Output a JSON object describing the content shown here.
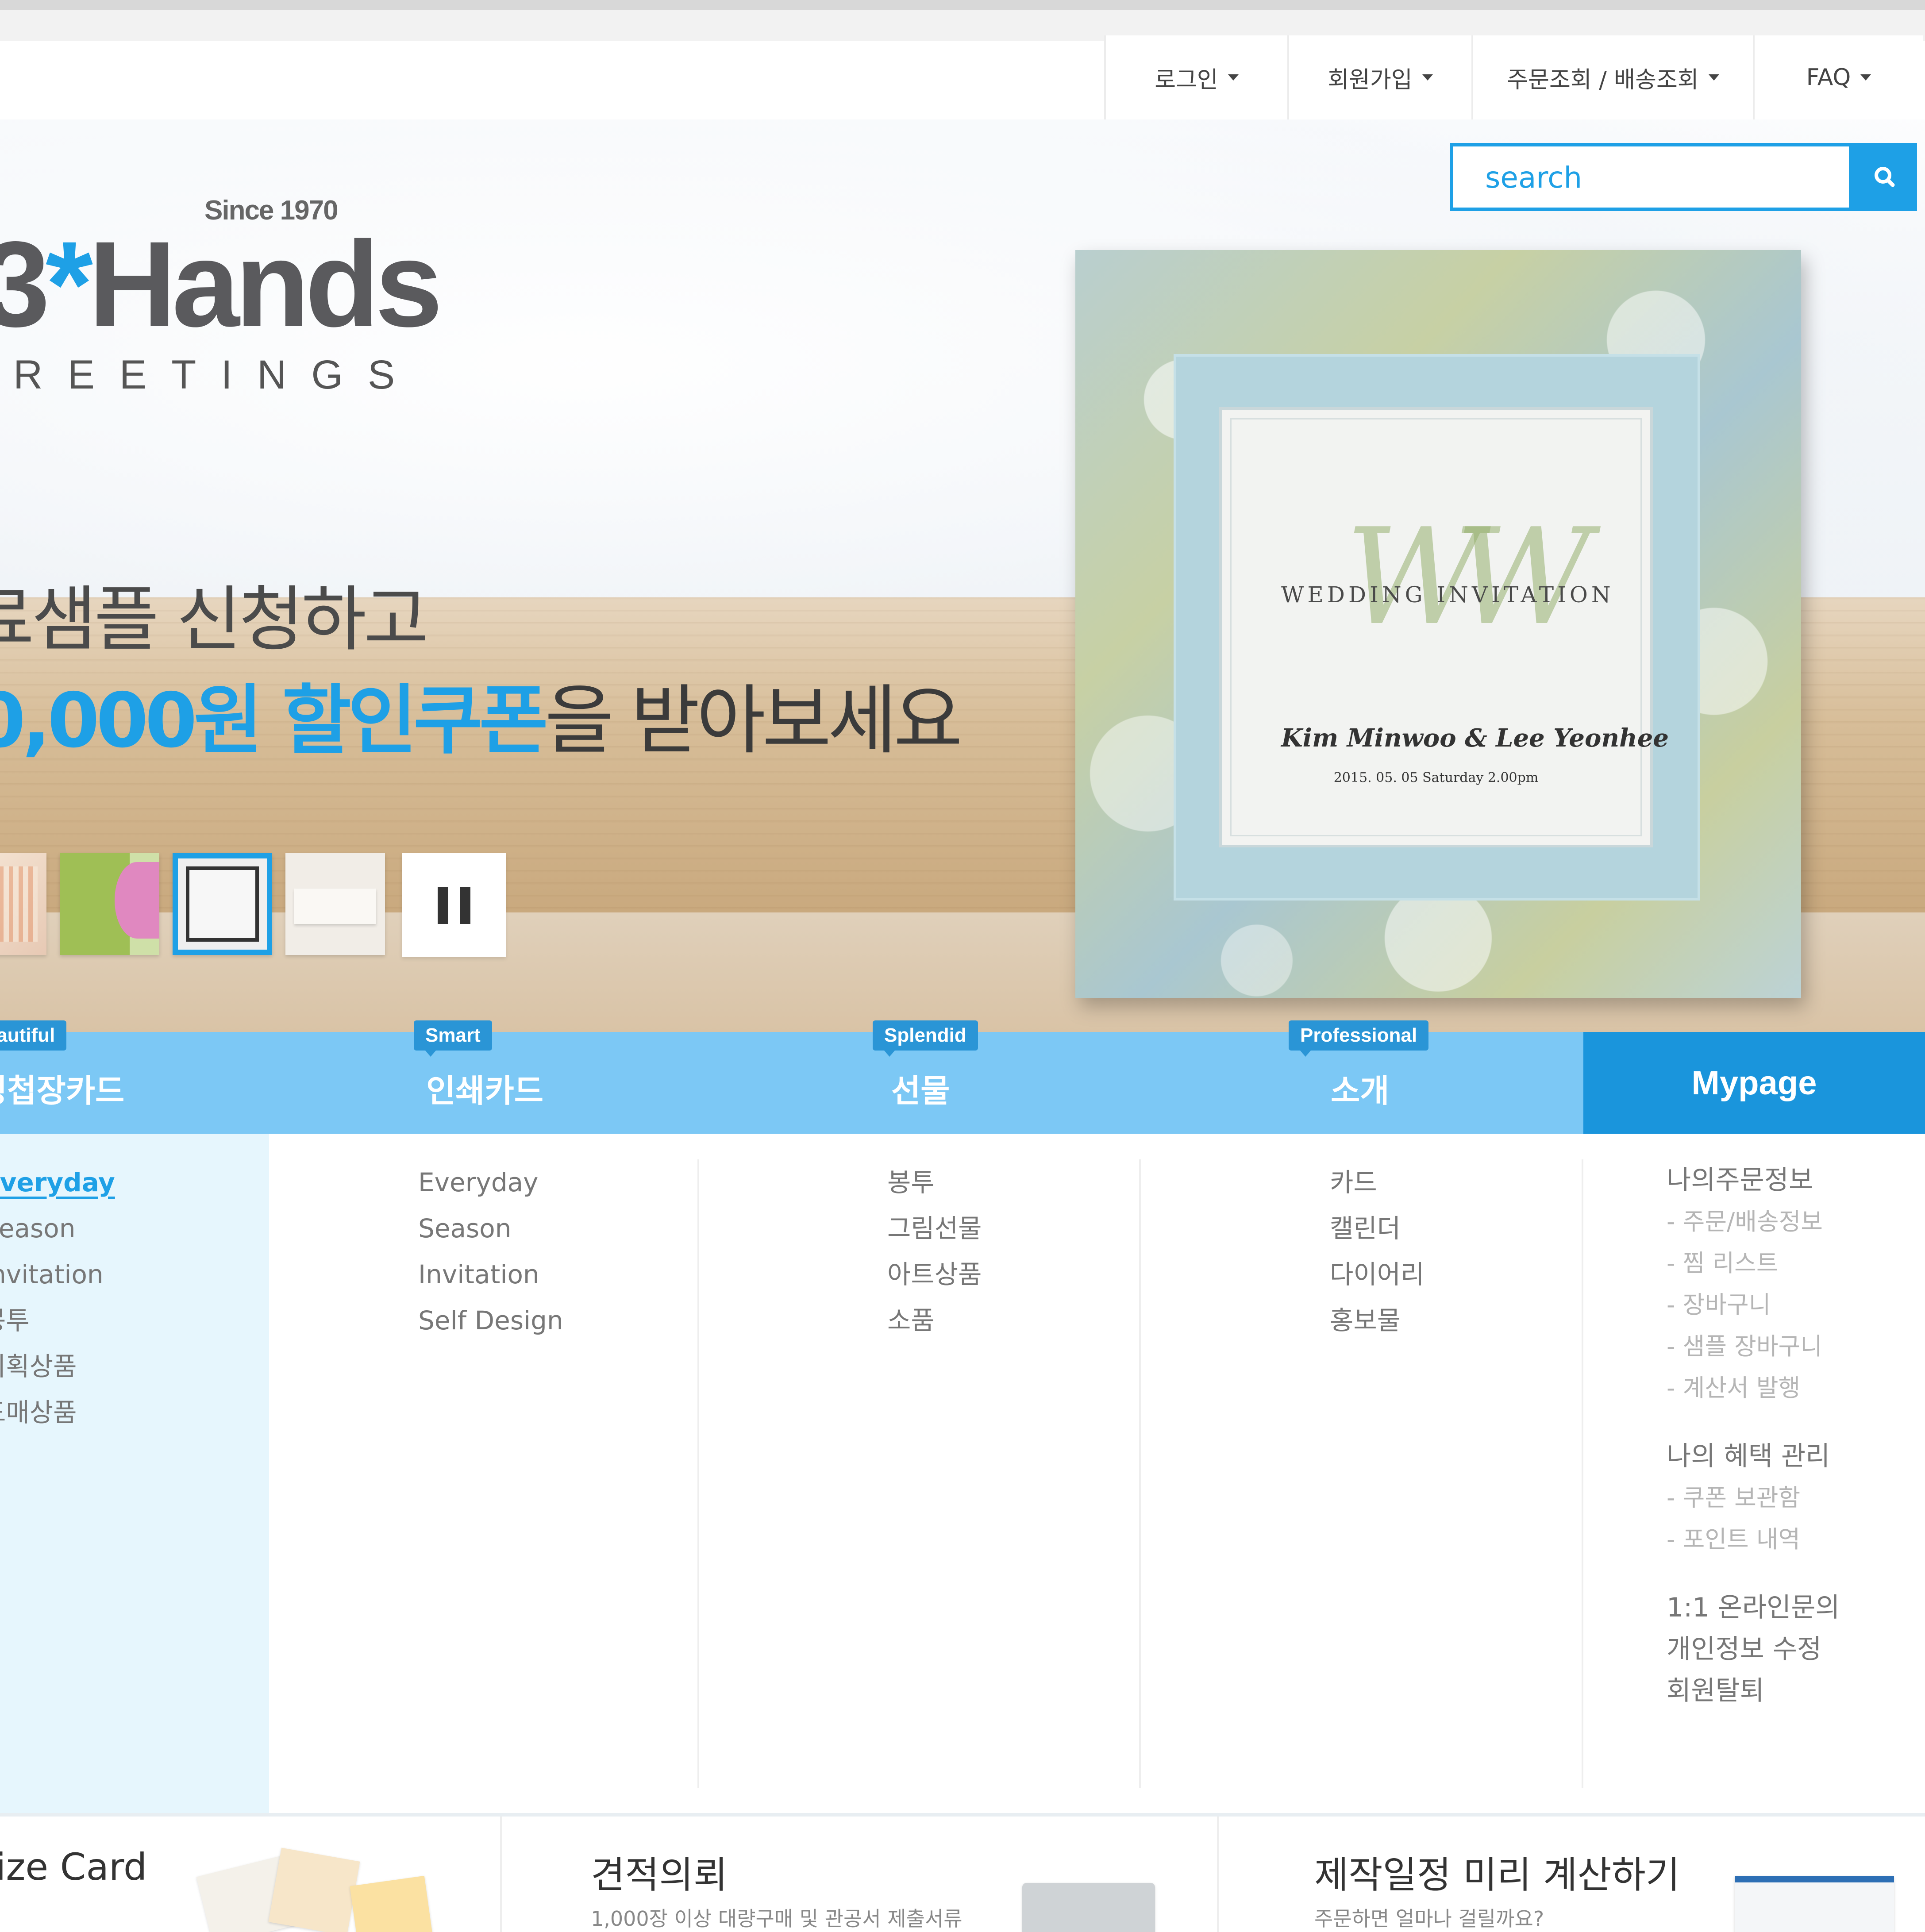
{
  "util_nav": {
    "login": "로그인",
    "join": "회원가입",
    "order": "주문조회 / 배송조회",
    "faq": "FAQ"
  },
  "search": {
    "placeholder": "search"
  },
  "logo": {
    "since": "Since 1970",
    "main_prefix": "3",
    "star": "*",
    "main_suffix": "Hands",
    "sub": "REETINGS"
  },
  "hero": {
    "line1": "료샘플 신청하고",
    "line2_num": "0,000원",
    "line2_blue": "할인쿠폰",
    "line2_rest": "을 받아보세요",
    "card_title": "WEDDING INVITATION",
    "card_names": "Kim Minwoo & Lee Yeonhee",
    "card_date": "2015. 05. 05 Saturday 2.00pm"
  },
  "categories": [
    {
      "badge": "Beautiful",
      "label": "청첩장카드"
    },
    {
      "badge": "Smart",
      "label": "인쇄카드"
    },
    {
      "badge": "Splendid",
      "label": "선물"
    },
    {
      "badge": "Professional",
      "label": "소개"
    }
  ],
  "mypage": "Mypage",
  "menu": {
    "col1": [
      "Everyday",
      "Season",
      "Invitation",
      "봉투",
      "기획상품",
      "도매상품"
    ],
    "col2": [
      "Everyday",
      "Season",
      "Invitation",
      "Self Design"
    ],
    "col3": [
      "봉투",
      "그림선물",
      "아트상품",
      "소품"
    ],
    "col4": [
      "카드",
      "캘린더",
      "다이어리",
      "홍보물"
    ],
    "mypage": {
      "order_head": "나의주문정보",
      "order_items": [
        "- 주문/배송정보",
        "- 찜 리스트",
        "- 장바구니",
        "- 샘플 장바구니",
        "- 계산서 발행"
      ],
      "benefit_head": "나의 혜택 관리",
      "benefit_items": [
        "- 쿠폰 보관함",
        "- 포인트 내역"
      ],
      "qna": "1:1 온라인문의",
      "edit": "개인정보 수정",
      "leave": "회원탈퇴"
    }
  },
  "promos": [
    {
      "title": "ize Card",
      "desc": ""
    },
    {
      "title": "견적의뢰",
      "desc": "1,000장 이상 대량구매 및 관공서 제출서류"
    },
    {
      "title": "제작일정 미리 계산하기",
      "desc": "주문하면 얼마나 걸릴까요?"
    }
  ],
  "colors": {
    "accent": "#1ea0e6",
    "category_bar": "#7cc8f5",
    "mypage_bg": "#1a95dc"
  }
}
